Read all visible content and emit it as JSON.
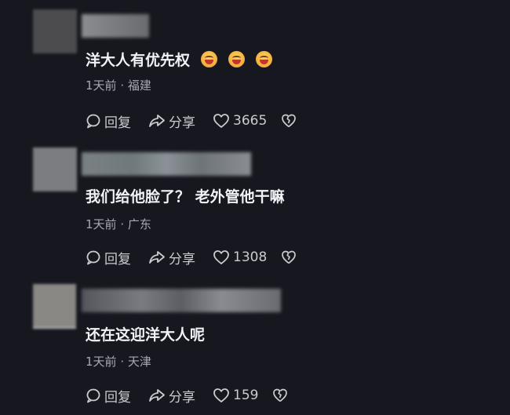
{
  "comments": [
    {
      "text": "洋大人有优先权",
      "emojis": [
        "grinning-face-emoji",
        "grinning-face-emoji",
        "grinning-face-emoji"
      ],
      "time": "1天前",
      "location": "福建",
      "reply_label": "回复",
      "share_label": "分享",
      "likes": "3665"
    },
    {
      "text": "我们给他脸了？ 老外管他干嘛",
      "emojis": [],
      "time": "1天前",
      "location": "广东",
      "reply_label": "回复",
      "share_label": "分享",
      "likes": "1308"
    },
    {
      "text": "还在这迎洋大人呢",
      "emojis": [],
      "time": "1天前",
      "location": "天津",
      "reply_label": "回复",
      "share_label": "分享",
      "likes": "159"
    }
  ],
  "meta_separator": "·",
  "icons": {
    "reply": "reply-bubble-icon",
    "share": "share-arrow-icon",
    "like": "heart-icon",
    "dislike": "broken-heart-icon"
  },
  "colors": {
    "background": "#17181f",
    "text": "#f1f2f5",
    "meta": "#a7a9b0",
    "action": "#c9cbd1"
  }
}
